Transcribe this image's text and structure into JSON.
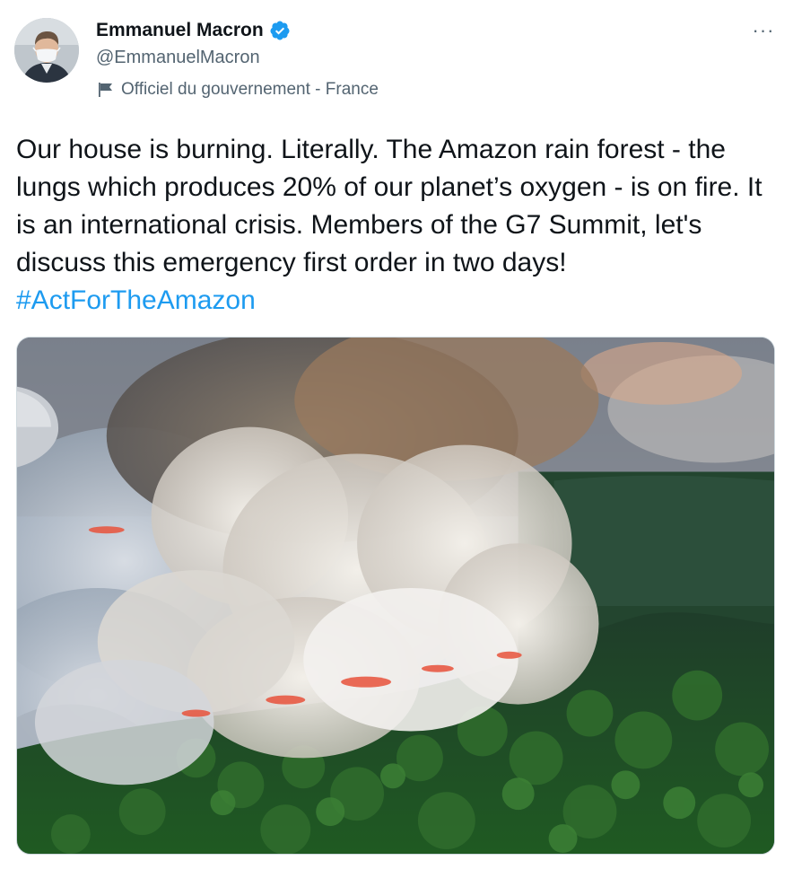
{
  "author": {
    "display_name": "Emmanuel Macron",
    "handle": "@EmmanuelMacron",
    "verified": true,
    "label": "Officiel du gouvernement - France",
    "label_icon": "flag-icon",
    "avatar_icon": "avatar"
  },
  "more_label": "···",
  "tweet": {
    "text": "Our house is burning. Literally. The Amazon rain forest - the lungs which produces 20% of our planet’s oxygen - is on fire. It is an international crisis. Members of the G7 Summit, let's discuss this emergency first order in two days! ",
    "hashtag": "#ActForTheAmazon"
  },
  "colors": {
    "link": "#1d9bf0",
    "verified_badge": "#1d9bf0",
    "secondary_text": "#536471",
    "primary_text": "#0f1419"
  }
}
